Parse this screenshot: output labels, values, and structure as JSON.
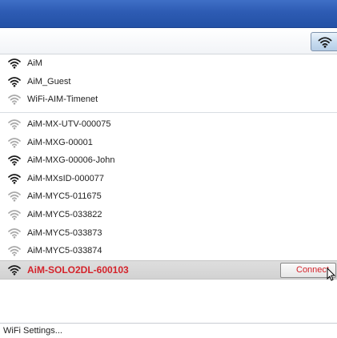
{
  "networks_group1": [
    {
      "name": "AiM",
      "signal": "strong"
    },
    {
      "name": "AiM_Guest",
      "signal": "strong"
    },
    {
      "name": "WiFi-AIM-Timenet",
      "signal": "weak"
    }
  ],
  "networks_group2": [
    {
      "name": "AiM-MX-UTV-000075",
      "signal": "weak"
    },
    {
      "name": "AiM-MXG-00001",
      "signal": "weak"
    },
    {
      "name": "AiM-MXG-00006-John",
      "signal": "strong"
    },
    {
      "name": "AiM-MXsID-000077",
      "signal": "strong"
    },
    {
      "name": "AiM-MYC5-011675",
      "signal": "weak"
    },
    {
      "name": "AiM-MYC5-033822",
      "signal": "weak"
    },
    {
      "name": "AiM-MYC5-033873",
      "signal": "weak"
    },
    {
      "name": "AiM-MYC5-033874",
      "signal": "weak"
    }
  ],
  "selected_network": {
    "name": "AiM-SOLO2DL-600103",
    "signal": "strong",
    "connect_label": "Connect"
  },
  "footer": {
    "settings_label": "WiFi Settings..."
  },
  "icons": {
    "toolbar": "wifi-toggle-icon",
    "network": "wifi-signal-icon",
    "cursor": "mouse-pointer-icon"
  },
  "colors": {
    "titlebar": "#2d5bb3",
    "selected_text": "#d4232b",
    "strong_signal": "#1a1a1a",
    "weak_signal": "#a9a9a9"
  }
}
